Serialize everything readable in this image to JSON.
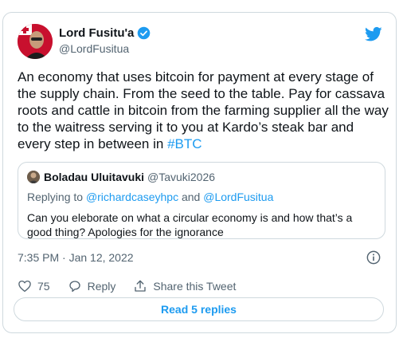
{
  "tweet": {
    "author": {
      "name": "Lord Fusitu'a",
      "handle": "@LordFusitua",
      "verified": true
    },
    "text_main": "An economy that uses bitcoin for payment at every stage of the supply chain. From the seed to the table. Pay for cassava roots and cattle in bitcoin from the farming supplier all the way to the waitress serving it to you at Kardo’s steak bar and every step in between in ",
    "hashtag": "#BTC",
    "timestamp": "7:35 PM · Jan 12, 2022",
    "likes": "75",
    "reply_label": "Reply",
    "share_label": "Share this Tweet",
    "read_replies_label": "Read 5 replies"
  },
  "quoted": {
    "name": "Boladau Uluitavuki",
    "handle": "@Tavuki2026",
    "replying_prefix": "Replying to ",
    "mention1": "@richardcaseyhpc",
    "and": " and ",
    "mention2": "@LordFusitua",
    "text": "Can you eleborate on what a circular economy is and how that’s a good thing? Apologies for the ignorance"
  },
  "icons": {
    "twitter": "twitter-bird-icon",
    "verified": "verified-badge-icon",
    "info": "info-icon",
    "like": "heart-icon",
    "reply": "reply-bubble-icon",
    "share": "share-icon"
  },
  "colors": {
    "accent": "#1d9bf0",
    "text": "#0f1419",
    "muted": "#536471",
    "border": "#cfd9de"
  }
}
